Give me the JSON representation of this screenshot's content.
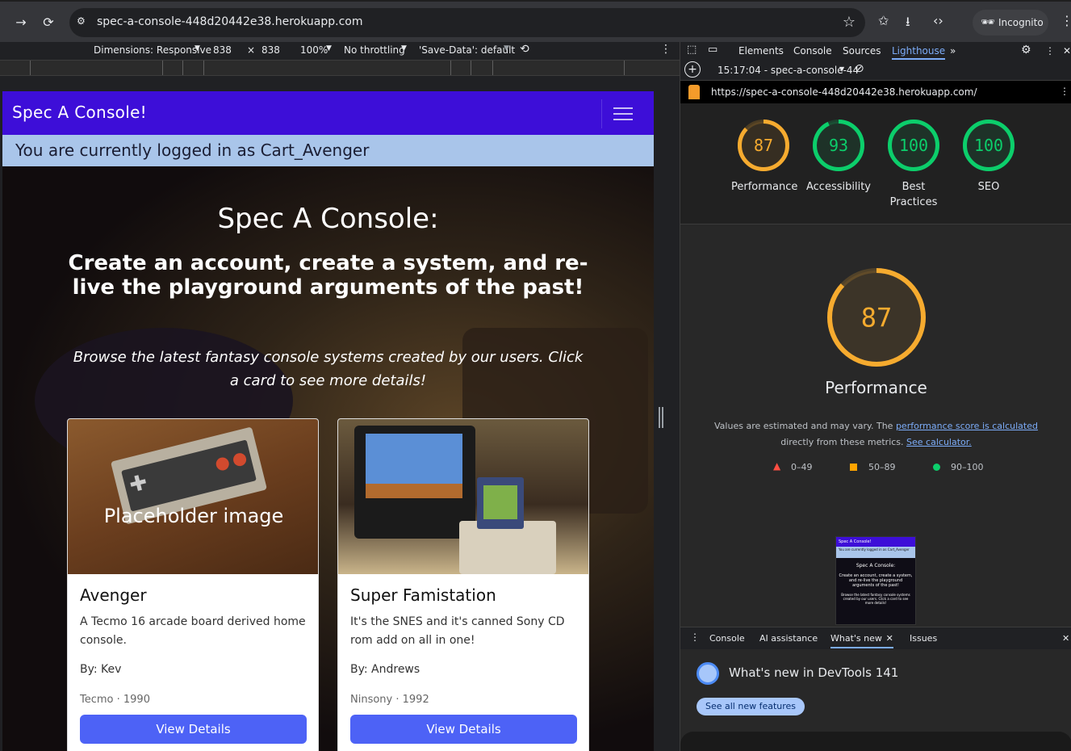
{
  "browser": {
    "url": "spec-a-console-448d20442e38.herokuapp.com",
    "incognito_label": "Incognito",
    "icons": [
      "back-icon",
      "reload-icon",
      "site-settings-icon",
      "bookmark-star-icon",
      "extensions-icon",
      "download-icon",
      "devtools-icon",
      "menu-icon"
    ]
  },
  "device_toolbar": {
    "dimensions": "Dimensions: Responsive",
    "width": "838",
    "times": "×",
    "height": "838",
    "zoom": "100%",
    "throttling": "No throttling",
    "save_data": "'Save-Data': default"
  },
  "site": {
    "brand": "Spec A Console!",
    "logged_in": "You are currently logged in as Cart_Avenger",
    "hero_title": "Spec A Console:",
    "hero_subtitle": "Create an account, create a system, and re-live the playground arguments of the past!",
    "hero_text": "Browse the latest fantasy console systems created by our users. Click a card to see more details!",
    "cards": [
      {
        "image_caption": "Placeholder image",
        "title": "Avenger",
        "description": "A Tecmo 16 arcade board derived home console.",
        "by": "By: Kev",
        "meta": "Tecmo · 1990",
        "button": "View Details"
      },
      {
        "image_caption": "",
        "title": "Super Famistation",
        "description": "It's the SNES and it's canned Sony CD rom add on all in one!",
        "by": "By: Andrews",
        "meta": "Ninsony · 1992",
        "button": "View Details"
      }
    ]
  },
  "devtools": {
    "tabs": [
      "Elements",
      "Console",
      "Sources",
      "Lighthouse"
    ],
    "more": "»",
    "report_label": "15:17:04 - spec-a-console-44",
    "report_url": "https://spec-a-console-448d20442e38.herokuapp.com/",
    "scores": [
      {
        "label": "Performance",
        "value": 87,
        "color": "#f6ab2f"
      },
      {
        "label": "Accessibility",
        "value": 93,
        "color": "#0cce6b"
      },
      {
        "label": "Best\nPractices",
        "value": 100,
        "color": "#0cce6b"
      },
      {
        "label": "SEO",
        "value": 100,
        "color": "#0cce6b"
      }
    ],
    "main_score": 87,
    "main_label": "Performance",
    "note_prefix": "Values are estimated and may vary. The",
    "note_link1": "performance score is calculated",
    "note_mid": "directly from these metrics.",
    "note_link2": "See calculator.",
    "legend": [
      {
        "label": "0–49",
        "color": "#ff4e42"
      },
      {
        "label": "50–89",
        "color": "#ffa400"
      },
      {
        "label": "90–100",
        "color": "#0cce6b"
      }
    ],
    "thumb": {
      "brand": "Spec A Console!",
      "logged": "You are currently logged in as Cart_Avenger",
      "title": "Spec A Console:",
      "subtitle": "Create an account, create a system, and re-live the playground arguments of the past!",
      "text": "Browse the latest fantasy console systems created by our users. Click a card to see more details!"
    },
    "drawer_tabs": [
      "Console",
      "AI assistance",
      "What's new",
      "Issues"
    ],
    "whats_new_title": "What's new in DevTools 141",
    "whats_new_button": "See all new features"
  }
}
